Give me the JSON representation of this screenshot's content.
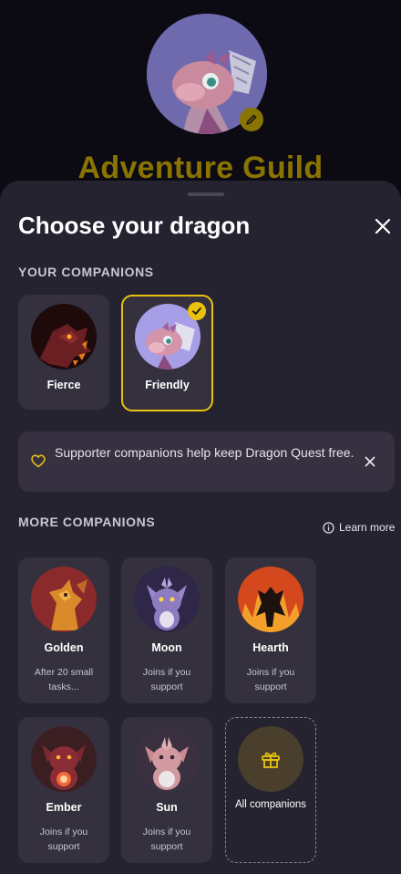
{
  "background": {
    "title": "Adventure Guild"
  },
  "sheet": {
    "title": "Choose your dragon",
    "your_companions_label": "YOUR COMPANIONS",
    "more_companions_label": "MORE COMPANIONS",
    "learn_more": "Learn more",
    "banner_text": "Supporter companions help keep Dragon Quest free."
  },
  "your_companions": [
    {
      "name": "Fierce",
      "selected": false
    },
    {
      "name": "Friendly",
      "selected": true
    }
  ],
  "more_companions": [
    {
      "name": "Golden",
      "subtitle": "After 20 small tasks..."
    },
    {
      "name": "Moon",
      "subtitle": "Joins if you support"
    },
    {
      "name": "Hearth",
      "subtitle": "Joins if you support"
    },
    {
      "name": "Ember",
      "subtitle": "Joins if you support"
    },
    {
      "name": "Sun",
      "subtitle": "Joins if you support"
    }
  ],
  "all_companions_label": "All companions",
  "colors": {
    "accent": "#e8c20f",
    "sheet_bg": "#262330",
    "card_bg": "#34303e"
  }
}
